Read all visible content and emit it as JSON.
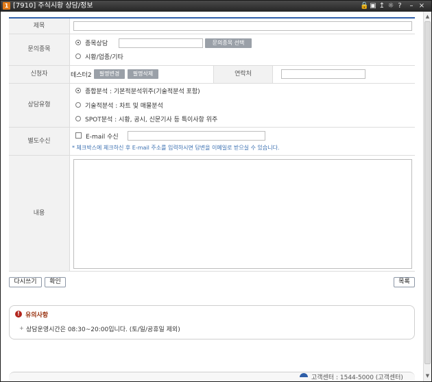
{
  "window": {
    "icon_text": "1",
    "title": "[7910] 주식시황 상담/정보",
    "controls": [
      "🔒",
      "▣",
      "↥",
      "☼",
      "?",
      "–",
      "×"
    ]
  },
  "form": {
    "title_label": "제목",
    "title_value": "",
    "inquiry_label": "문의종목",
    "inquiry_stock_consult": "종목상담",
    "stock_value": "",
    "select_stock_button": "문의종목 선택",
    "inquiry_market_other": "시황/업종/기타",
    "applicant_label": "신청자",
    "applicant_name": "테스터2",
    "nickname_change_button": "필명변경",
    "nickname_delete_button": "필명삭제",
    "contact_label": "연락처",
    "contact_value": "",
    "consult_type_label": "상담유형",
    "consult_types": [
      "종합분석 : 기본적분석위주(기술적분석 포함)",
      "기술적분석 : 차트 및 매물분석",
      "SPOT분석 : 시황, 공시, 신문기사 등 특이사항 위주"
    ],
    "separate_receive_label": "별도수신",
    "email_checkbox_label": "E-mail 수신",
    "email_value": "",
    "email_hint": "* 체크박스에 체크하신 후 E-mail 주소를 입력하시면 답변을 이메일로 받으실 수 있습니다.",
    "content_label": "내용",
    "content_value": ""
  },
  "actions": {
    "rewrite_button": "다시쓰기",
    "confirm_button": "확인",
    "list_button": "목록"
  },
  "notice": {
    "title": "유의사항",
    "item": "상담운영시간은 08:30~20:00입니다. (토/일/공휴일 제외)"
  },
  "footer": {
    "text": "고객센터 : 1544-5000 (고객센터)"
  },
  "colors": {
    "accent_line": "#2e5ea8",
    "label_bg": "#f2f2f2",
    "hint_text": "#3a6fb0",
    "notice_icon": "#b3261e",
    "gray_button": "#9aa0a8"
  }
}
